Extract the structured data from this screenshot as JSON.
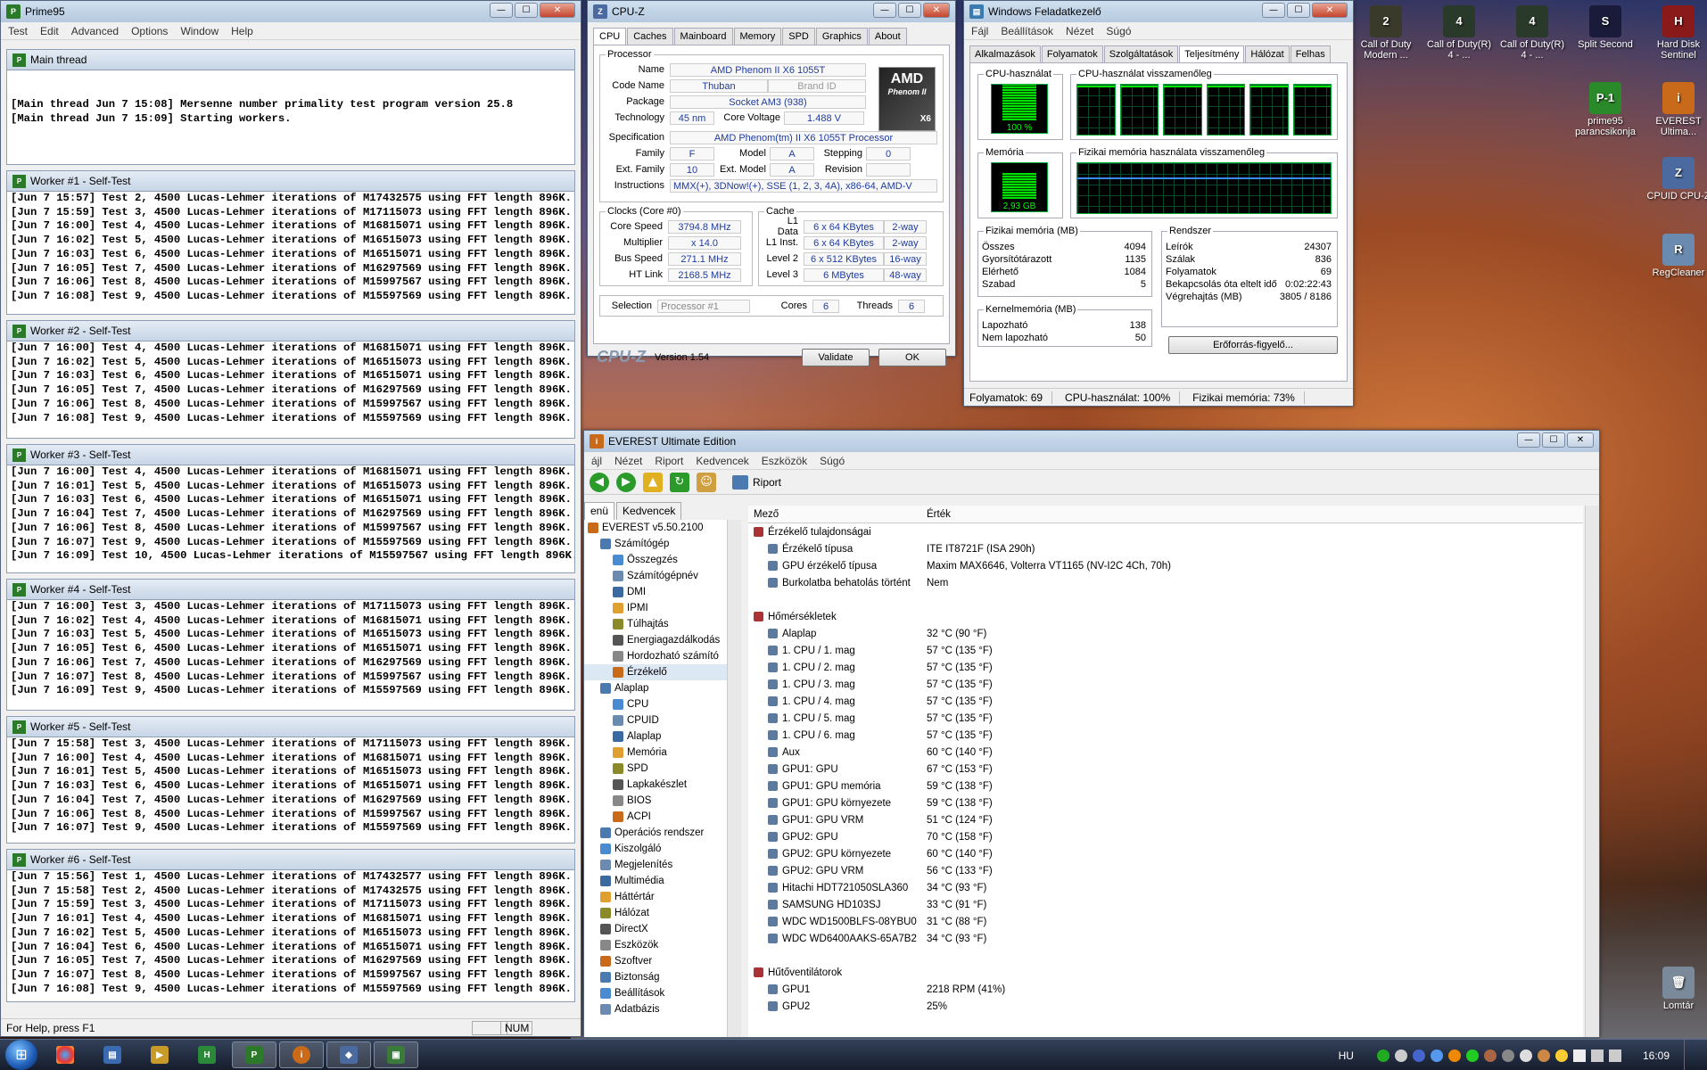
{
  "prime95": {
    "title": "Prime95",
    "menu": [
      "Test",
      "Edit",
      "Advanced",
      "Options",
      "Window",
      "Help"
    ],
    "main_thread": {
      "title": "Main thread",
      "lines": [
        "",
        "",
        "[Main thread Jun 7 15:08] Mersenne number primality test program version 25.8",
        "[Main thread Jun 7 15:09] Starting workers."
      ]
    },
    "workers": [
      {
        "title": "Worker #1 - Self-Test",
        "lines": [
          "[Jun 7 15:57] Test 2, 4500 Lucas-Lehmer iterations of M17432575 using FFT length 896K.",
          "[Jun 7 15:59] Test 3, 4500 Lucas-Lehmer iterations of M17115073 using FFT length 896K.",
          "[Jun 7 16:00] Test 4, 4500 Lucas-Lehmer iterations of M16815071 using FFT length 896K.",
          "[Jun 7 16:02] Test 5, 4500 Lucas-Lehmer iterations of M16515073 using FFT length 896K.",
          "[Jun 7 16:03] Test 6, 4500 Lucas-Lehmer iterations of M16515071 using FFT length 896K.",
          "[Jun 7 16:05] Test 7, 4500 Lucas-Lehmer iterations of M16297569 using FFT length 896K.",
          "[Jun 7 16:06] Test 8, 4500 Lucas-Lehmer iterations of M15997567 using FFT length 896K.",
          "[Jun 7 16:08] Test 9, 4500 Lucas-Lehmer iterations of M15597569 using FFT length 896K."
        ]
      },
      {
        "title": "Worker #2 - Self-Test",
        "lines": [
          "[Jun 7 16:00] Test 4, 4500 Lucas-Lehmer iterations of M16815071 using FFT length 896K.",
          "[Jun 7 16:02] Test 5, 4500 Lucas-Lehmer iterations of M16515073 using FFT length 896K.",
          "[Jun 7 16:03] Test 6, 4500 Lucas-Lehmer iterations of M16515071 using FFT length 896K.",
          "[Jun 7 16:05] Test 7, 4500 Lucas-Lehmer iterations of M16297569 using FFT length 896K.",
          "[Jun 7 16:06] Test 8, 4500 Lucas-Lehmer iterations of M15997567 using FFT length 896K.",
          "[Jun 7 16:08] Test 9, 4500 Lucas-Lehmer iterations of M15597569 using FFT length 896K."
        ]
      },
      {
        "title": "Worker #3 - Self-Test",
        "lines": [
          "[Jun 7 16:00] Test 4, 4500 Lucas-Lehmer iterations of M16815071 using FFT length 896K.",
          "[Jun 7 16:01] Test 5, 4500 Lucas-Lehmer iterations of M16515073 using FFT length 896K.",
          "[Jun 7 16:03] Test 6, 4500 Lucas-Lehmer iterations of M16515071 using FFT length 896K.",
          "[Jun 7 16:04] Test 7, 4500 Lucas-Lehmer iterations of M16297569 using FFT length 896K.",
          "[Jun 7 16:06] Test 8, 4500 Lucas-Lehmer iterations of M15997567 using FFT length 896K.",
          "[Jun 7 16:07] Test 9, 4500 Lucas-Lehmer iterations of M15597569 using FFT length 896K.",
          "[Jun 7 16:09] Test 10, 4500 Lucas-Lehmer iterations of M15597567 using FFT length 896K."
        ]
      },
      {
        "title": "Worker #4 - Self-Test",
        "lines": [
          "[Jun 7 16:00] Test 3, 4500 Lucas-Lehmer iterations of M17115073 using FFT length 896K.",
          "[Jun 7 16:02] Test 4, 4500 Lucas-Lehmer iterations of M16815071 using FFT length 896K.",
          "[Jun 7 16:03] Test 5, 4500 Lucas-Lehmer iterations of M16515073 using FFT length 896K.",
          "[Jun 7 16:05] Test 6, 4500 Lucas-Lehmer iterations of M16515071 using FFT length 896K.",
          "[Jun 7 16:06] Test 7, 4500 Lucas-Lehmer iterations of M16297569 using FFT length 896K.",
          "[Jun 7 16:07] Test 8, 4500 Lucas-Lehmer iterations of M15997567 using FFT length 896K.",
          "[Jun 7 16:09] Test 9, 4500 Lucas-Lehmer iterations of M15597569 using FFT length 896K."
        ]
      },
      {
        "title": "Worker #5 - Self-Test",
        "lines": [
          "[Jun 7 15:58] Test 3, 4500 Lucas-Lehmer iterations of M17115073 using FFT length 896K.",
          "[Jun 7 16:00] Test 4, 4500 Lucas-Lehmer iterations of M16815071 using FFT length 896K.",
          "[Jun 7 16:01] Test 5, 4500 Lucas-Lehmer iterations of M16515073 using FFT length 896K.",
          "[Jun 7 16:03] Test 6, 4500 Lucas-Lehmer iterations of M16515071 using FFT length 896K.",
          "[Jun 7 16:04] Test 7, 4500 Lucas-Lehmer iterations of M16297569 using FFT length 896K.",
          "[Jun 7 16:06] Test 8, 4500 Lucas-Lehmer iterations of M15997567 using FFT length 896K.",
          "[Jun 7 16:07] Test 9, 4500 Lucas-Lehmer iterations of M15597569 using FFT length 896K."
        ]
      },
      {
        "title": "Worker #6 - Self-Test",
        "lines": [
          "[Jun 7 15:56] Test 1, 4500 Lucas-Lehmer iterations of M17432577 using FFT length 896K.",
          "[Jun 7 15:58] Test 2, 4500 Lucas-Lehmer iterations of M17432575 using FFT length 896K.",
          "[Jun 7 15:59] Test 3, 4500 Lucas-Lehmer iterations of M17115073 using FFT length 896K.",
          "[Jun 7 16:01] Test 4, 4500 Lucas-Lehmer iterations of M16815071 using FFT length 896K.",
          "[Jun 7 16:02] Test 5, 4500 Lucas-Lehmer iterations of M16515073 using FFT length 896K.",
          "[Jun 7 16:04] Test 6, 4500 Lucas-Lehmer iterations of M16515071 using FFT length 896K.",
          "[Jun 7 16:05] Test 7, 4500 Lucas-Lehmer iterations of M16297569 using FFT length 896K.",
          "[Jun 7 16:07] Test 8, 4500 Lucas-Lehmer iterations of M15997567 using FFT length 896K.",
          "[Jun 7 16:08] Test 9, 4500 Lucas-Lehmer iterations of M15597569 using FFT length 896K."
        ]
      }
    ],
    "status": "For Help, press F1",
    "num": "NUM"
  },
  "cpuz": {
    "title": "CPU-Z",
    "tabs": [
      "CPU",
      "Caches",
      "Mainboard",
      "Memory",
      "SPD",
      "Graphics",
      "About"
    ],
    "processor_legend": "Processor",
    "name_label": "Name",
    "name": "AMD Phenom II X6 1055T",
    "codename_label": "Code Name",
    "codename": "Thuban",
    "brandid_label": "Brand ID",
    "package_label": "Package",
    "package": "Socket AM3 (938)",
    "tech_label": "Technology",
    "tech": "45 nm",
    "voltage_label": "Core Voltage",
    "voltage": "1.488 V",
    "spec_label": "Specification",
    "spec": "AMD Phenom(tm) II X6 1055T Processor",
    "family_label": "Family",
    "family": "F",
    "model_label": "Model",
    "model": "A",
    "stepping_label": "Stepping",
    "stepping": "0",
    "extfamily_label": "Ext. Family",
    "extfamily": "10",
    "extmodel_label": "Ext. Model",
    "extmodel": "A",
    "revision_label": "Revision",
    "instr_label": "Instructions",
    "instr": "MMX(+), 3DNow!(+), SSE (1, 2, 3, 4A), x86-64, AMD-V",
    "clocks_legend": "Clocks (Core #0)",
    "corespeed_label": "Core Speed",
    "corespeed": "3794.8 MHz",
    "mult_label": "Multiplier",
    "mult": "x 14.0",
    "bus_label": "Bus Speed",
    "bus": "271.1 MHz",
    "ht_label": "HT Link",
    "ht": "2168.5 MHz",
    "cache_legend": "Cache",
    "l1d_label": "L1 Data",
    "l1d": "6 x 64 KBytes",
    "l1d_way": "2-way",
    "l1i_label": "L1 Inst.",
    "l1i": "6 x 64 KBytes",
    "l1i_way": "2-way",
    "l2_label": "Level 2",
    "l2": "6 x 512 KBytes",
    "l2_way": "16-way",
    "l3_label": "Level 3",
    "l3": "6 MBytes",
    "l3_way": "48-way",
    "selection_label": "Selection",
    "selection": "Processor #1",
    "cores_label": "Cores",
    "cores": "6",
    "threads_label": "Threads",
    "threads": "6",
    "logo": "CPU-Z",
    "version": "Version 1.54",
    "validate": "Validate",
    "ok": "OK",
    "amd_logo": "AMD",
    "amd_sub": "Phenom II",
    "amd_x6": "X6"
  },
  "taskmgr": {
    "title": "Windows Feladatkezelő",
    "menu": [
      "Fájl",
      "Beállítások",
      "Nézet",
      "Súgó"
    ],
    "tabs": [
      "Alkalmazások",
      "Folyamatok",
      "Szolgáltatások",
      "Teljesítmény",
      "Hálózat",
      "Felhas"
    ],
    "cpu_label": "CPU-használat",
    "cpu_value": "100 %",
    "cpu_pct": 100,
    "cpu_hist_label": "CPU-használat visszamenőleg",
    "mem_label": "Memória",
    "mem_value": "2,93 GB",
    "mem_pct": 73,
    "mem_hist_label": "Fizikai memória használata visszamenőleg",
    "phys_title": "Fizikai memória (MB)",
    "phys": [
      [
        "Összes",
        "4094"
      ],
      [
        "Gyorsítótárazott",
        "1135"
      ],
      [
        "Elérhető",
        "1084"
      ],
      [
        "Szabad",
        "5"
      ]
    ],
    "sys_title": "Rendszer",
    "sys": [
      [
        "Leírók",
        "24307"
      ],
      [
        "Szálak",
        "836"
      ],
      [
        "Folyamatok",
        "69"
      ],
      [
        "Bekapcsolás óta eltelt idő",
        "0:02:22:43"
      ],
      [
        "Végrehajtás (MB)",
        "3805 / 8186"
      ]
    ],
    "kern_title": "Kernelmemória (MB)",
    "kern": [
      [
        "Lapozható",
        "138"
      ],
      [
        "Nem lapozható",
        "50"
      ]
    ],
    "resmon": "Erőforrás-figyelő...",
    "status": [
      "Folyamatok: 69",
      "CPU-használat: 100%",
      "Fizikai memória: 73%"
    ]
  },
  "everest": {
    "title": "EVEREST Ultimate Edition",
    "menu": [
      "ájl",
      "Nézet",
      "Riport",
      "Kedvencek",
      "Eszközök",
      "Súgó"
    ],
    "report": "Riport",
    "tab_menu": "enü",
    "tab_fav": "Kedvencek",
    "tree": [
      {
        "t": "EVEREST v5.50.2100",
        "l": 0
      },
      {
        "t": "Számítógép",
        "l": 1
      },
      {
        "t": "Összegzés",
        "l": 2
      },
      {
        "t": "Számítógépnév",
        "l": 2
      },
      {
        "t": "DMI",
        "l": 2
      },
      {
        "t": "IPMI",
        "l": 2
      },
      {
        "t": "Túlhajtás",
        "l": 2
      },
      {
        "t": "Energiagazdálkodás",
        "l": 2
      },
      {
        "t": "Hordozható számító",
        "l": 2
      },
      {
        "t": "Érzékelő",
        "l": 2
      },
      {
        "t": "Alaplap",
        "l": 1
      },
      {
        "t": "CPU",
        "l": 2
      },
      {
        "t": "CPUID",
        "l": 2
      },
      {
        "t": "Alaplap",
        "l": 2
      },
      {
        "t": "Memória",
        "l": 2
      },
      {
        "t": "SPD",
        "l": 2
      },
      {
        "t": "Lapkakészlet",
        "l": 2
      },
      {
        "t": "BIOS",
        "l": 2
      },
      {
        "t": "ACPI",
        "l": 2
      },
      {
        "t": "Operációs rendszer",
        "l": 1
      },
      {
        "t": "Kiszolgáló",
        "l": 1
      },
      {
        "t": "Megjelenítés",
        "l": 1
      },
      {
        "t": "Multimédia",
        "l": 1
      },
      {
        "t": "Háttértár",
        "l": 1
      },
      {
        "t": "Hálózat",
        "l": 1
      },
      {
        "t": "DirectX",
        "l": 1
      },
      {
        "t": "Eszközök",
        "l": 1
      },
      {
        "t": "Szoftver",
        "l": 1
      },
      {
        "t": "Biztonság",
        "l": 1
      },
      {
        "t": "Beállítások",
        "l": 1
      },
      {
        "t": "Adatbázis",
        "l": 1
      }
    ],
    "col_field": "Mező",
    "col_value": "Érték",
    "rows": [
      {
        "f": "Érzékelő tulajdonságai",
        "v": "",
        "s": 1
      },
      {
        "f": "Érzékelő típusa",
        "v": "ITE IT8721F  (ISA 290h)"
      },
      {
        "f": "GPU érzékelő típusa",
        "v": "Maxim MAX6646, Volterra VT1165  (NV-I2C 4Ch, 70h)"
      },
      {
        "f": "Burkolatba behatolás történt",
        "v": "Nem"
      },
      {
        "f": "",
        "v": ""
      },
      {
        "f": "Hőmérsékletek",
        "v": "",
        "s": 1
      },
      {
        "f": "Alaplap",
        "v": "32 °C  (90 °F)"
      },
      {
        "f": "1. CPU / 1. mag",
        "v": "57 °C  (135 °F)"
      },
      {
        "f": "1. CPU / 2. mag",
        "v": "57 °C  (135 °F)"
      },
      {
        "f": "1. CPU / 3. mag",
        "v": "57 °C  (135 °F)"
      },
      {
        "f": "1. CPU / 4. mag",
        "v": "57 °C  (135 °F)"
      },
      {
        "f": "1. CPU / 5. mag",
        "v": "57 °C  (135 °F)"
      },
      {
        "f": "1. CPU / 6. mag",
        "v": "57 °C  (135 °F)"
      },
      {
        "f": "Aux",
        "v": "60 °C  (140 °F)"
      },
      {
        "f": "GPU1: GPU",
        "v": "67 °C  (153 °F)"
      },
      {
        "f": "GPU1: GPU memória",
        "v": "59 °C  (138 °F)"
      },
      {
        "f": "GPU1: GPU környezete",
        "v": "59 °C  (138 °F)"
      },
      {
        "f": "GPU1: GPU VRM",
        "v": "51 °C  (124 °F)"
      },
      {
        "f": "GPU2: GPU",
        "v": "70 °C  (158 °F)"
      },
      {
        "f": "GPU2: GPU környezete",
        "v": "60 °C  (140 °F)"
      },
      {
        "f": "GPU2: GPU VRM",
        "v": "56 °C  (133 °F)"
      },
      {
        "f": "Hitachi HDT721050SLA360",
        "v": "34 °C  (93 °F)"
      },
      {
        "f": "SAMSUNG HD103SJ",
        "v": "33 °C  (91 °F)"
      },
      {
        "f": "WDC WD1500BLFS-08YBU0",
        "v": "31 °C  (88 °F)"
      },
      {
        "f": "WDC WD6400AAKS-65A7B2",
        "v": "34 °C  (93 °F)"
      },
      {
        "f": "",
        "v": ""
      },
      {
        "f": "Hűtőventilátorok",
        "v": "",
        "s": 1
      },
      {
        "f": "GPU1",
        "v": "2218 RPM  (41%)"
      },
      {
        "f": "GPU2",
        "v": "25%"
      }
    ]
  },
  "desktop_icons": [
    {
      "t": "Call of Duty Modern ...",
      "c": "#3a3a2a",
      "g": "2"
    },
    {
      "t": "Call of Duty(R) 4 - ...",
      "c": "#2a3a2a",
      "g": "4"
    },
    {
      "t": "Call of Duty(R) 4 - ...",
      "c": "#2a3a2a",
      "g": "4"
    },
    {
      "t": "Split Second",
      "c": "#1a1a3a",
      "g": "S"
    },
    {
      "t": "Hard Disk Sentinel",
      "c": "#8a1a1a",
      "g": "H"
    },
    {
      "t": "prime95 parancsikonja",
      "c": "#2a8a2a",
      "g": "P-1"
    },
    {
      "t": "EVEREST Ultima...",
      "c": "#c86a1a",
      "g": "i"
    },
    {
      "t": "CPUID CPU-Z",
      "c": "#4a6aa0",
      "g": "Z"
    },
    {
      "t": "RegCleaner",
      "c": "#6a8ab0",
      "g": "R"
    },
    {
      "t": "Lomtár",
      "c": "#7a8a9a",
      "g": "🗑"
    }
  ],
  "taskbar": {
    "lang": "HU",
    "clock": "16:09"
  }
}
